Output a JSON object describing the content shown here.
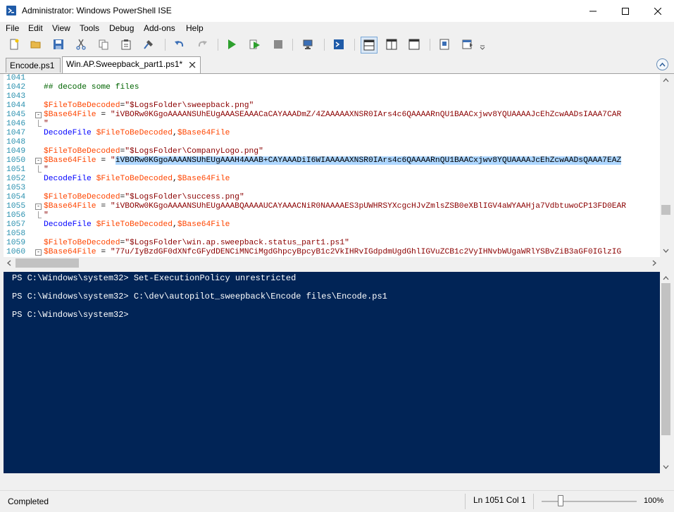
{
  "window": {
    "title": "Administrator: Windows PowerShell ISE",
    "minimize_icon": "minimize-icon",
    "maximize_icon": "maximize-icon",
    "close_icon": "close-icon"
  },
  "menu": [
    "File",
    "Edit",
    "View",
    "Tools",
    "Debug",
    "Add-ons",
    "Help"
  ],
  "toolbar": {
    "icons": [
      "new-file-icon",
      "open-folder-icon",
      "save-icon",
      "cut-icon",
      "copy-icon",
      "paste-icon",
      "clear-console-icon",
      "undo-icon",
      "redo-icon",
      "run-script-icon",
      "run-selection-icon",
      "stop-icon",
      "new-remote-tab-icon",
      "start-powershell-icon",
      "show-script-top-icon",
      "show-script-right-icon",
      "show-script-max-icon",
      "show-command-window-icon",
      "show-command-addon-icon",
      "overflow-chevron-icon"
    ]
  },
  "tabs": [
    {
      "label": "Encode.ps1",
      "active": false
    },
    {
      "label": "Win.AP.Sweepback_part1.ps1*",
      "active": true
    }
  ],
  "editor": {
    "lines": [
      {
        "n": "1041",
        "tokens": []
      },
      {
        "n": "1042",
        "tokens": [
          {
            "t": "## decode some files",
            "c": "comment"
          }
        ]
      },
      {
        "n": "1043",
        "tokens": []
      },
      {
        "n": "1044",
        "tokens": [
          {
            "t": "$FileToBeDecoded",
            "c": "var"
          },
          {
            "t": "=",
            "c": "norm"
          },
          {
            "t": "\"$LogsFolder\\sweepback.png\"",
            "c": "str"
          }
        ]
      },
      {
        "n": "1045",
        "fold": "-",
        "tokens": [
          {
            "t": "$Base64File",
            "c": "var"
          },
          {
            "t": " = ",
            "c": "norm"
          },
          {
            "t": "\"iVBORw0KGgoAAAANSUhEUgAAASEAAACaCAYAAADmZ/4ZAAAAAXNSR0IArs4c6QAAAARnQU1BAACxjwv8YQUAAAAJcEhZcwAADsIAAA7CAR",
            "c": "str"
          }
        ]
      },
      {
        "n": "1046",
        "guide": true,
        "tokens": [
          {
            "t": "\"",
            "c": "str"
          }
        ]
      },
      {
        "n": "1047",
        "tokens": [
          {
            "t": "DecodeFile",
            "c": "cmd"
          },
          {
            "t": " ",
            "c": "norm"
          },
          {
            "t": "$FileToBeDecoded",
            "c": "var"
          },
          {
            "t": ",",
            "c": "norm"
          },
          {
            "t": "$Base64File",
            "c": "var"
          }
        ]
      },
      {
        "n": "1048",
        "tokens": []
      },
      {
        "n": "1049",
        "tokens": [
          {
            "t": "$FileToBeDecoded",
            "c": "var"
          },
          {
            "t": "=",
            "c": "norm"
          },
          {
            "t": "\"$LogsFolder\\CompanyLogo.png\"",
            "c": "str"
          }
        ]
      },
      {
        "n": "1050",
        "fold": "-",
        "tokens": [
          {
            "t": "$Base64File",
            "c": "var"
          },
          {
            "t": " = ",
            "c": "norm"
          },
          {
            "t": "\"",
            "c": "str"
          },
          {
            "t": "iVBORw0KGgoAAAANSUhEUgAAAH4AAAB+CAYAAADiI6WIAAAAAXNSR0IArs4c6QAAAARnQU1BAACxjwv8YQUAAAAJcEhZcwAADsQAAA7EAZ",
            "c": "hl"
          }
        ]
      },
      {
        "n": "1051",
        "guide": true,
        "tokens": [
          {
            "t": "\"",
            "c": "str"
          }
        ]
      },
      {
        "n": "1052",
        "tokens": [
          {
            "t": "DecodeFile",
            "c": "cmd"
          },
          {
            "t": " ",
            "c": "norm"
          },
          {
            "t": "$FileToBeDecoded",
            "c": "var"
          },
          {
            "t": ",",
            "c": "norm"
          },
          {
            "t": "$Base64File",
            "c": "var"
          }
        ]
      },
      {
        "n": "1053",
        "tokens": []
      },
      {
        "n": "1054",
        "tokens": [
          {
            "t": "$FileToBeDecoded",
            "c": "var"
          },
          {
            "t": "=",
            "c": "norm"
          },
          {
            "t": "\"$LogsFolder\\success.png\"",
            "c": "str"
          }
        ]
      },
      {
        "n": "1055",
        "fold": "-",
        "tokens": [
          {
            "t": "$Base64File",
            "c": "var"
          },
          {
            "t": " = ",
            "c": "norm"
          },
          {
            "t": "\"iVBORw0KGgoAAAANSUhEUgAAABQAAAAUCAYAAACNiR0NAAAAES3pUWHRSYXcgcHJvZmlsZSB0eXBlIGV4aWYAAHja7VdbtuwoCP13FD0EAR",
            "c": "str"
          }
        ]
      },
      {
        "n": "1056",
        "guide": true,
        "tokens": [
          {
            "t": "\"",
            "c": "str"
          }
        ]
      },
      {
        "n": "1057",
        "tokens": [
          {
            "t": "DecodeFile",
            "c": "cmd"
          },
          {
            "t": " ",
            "c": "norm"
          },
          {
            "t": "$FileToBeDecoded",
            "c": "var"
          },
          {
            "t": ",",
            "c": "norm"
          },
          {
            "t": "$Base64File",
            "c": "var"
          }
        ]
      },
      {
        "n": "1058",
        "tokens": []
      },
      {
        "n": "1059",
        "tokens": [
          {
            "t": "$FileToBeDecoded",
            "c": "var"
          },
          {
            "t": "=",
            "c": "norm"
          },
          {
            "t": "\"$LogsFolder\\win.ap.sweepback.status_part1.ps1\"",
            "c": "str"
          }
        ]
      },
      {
        "n": "1060",
        "fold": "-",
        "tokens": [
          {
            "t": "$Base64File",
            "c": "var"
          },
          {
            "t": " = ",
            "c": "norm"
          },
          {
            "t": "\"77u/IyBzdGF0dXNfcGFydDENCiMNCiMgdGhpcyBpcyB1c2VkIHRvIGdpdmUgdGhlIGVuZCB1c2VyIHNvbWUgaWRlYSBvZiB3aGF0IGlzIG",
            "c": "str"
          }
        ]
      }
    ]
  },
  "console": {
    "lines": [
      "PS C:\\Windows\\system32> Set-ExecutionPolicy unrestricted",
      "PS C:\\Windows\\system32> C:\\dev\\autopilot_sweepback\\Encode files\\Encode.ps1",
      "PS C:\\Windows\\system32>"
    ]
  },
  "status": {
    "text": "Completed",
    "position": "Ln 1051  Col 1",
    "zoom": "100%"
  },
  "colors": {
    "console_bg": "#012456",
    "variable": "#ff4500",
    "string": "#8b0000",
    "command": "#0000ff",
    "comment": "#006400",
    "line_number": "#2b91af",
    "selection": "#add6ff"
  }
}
